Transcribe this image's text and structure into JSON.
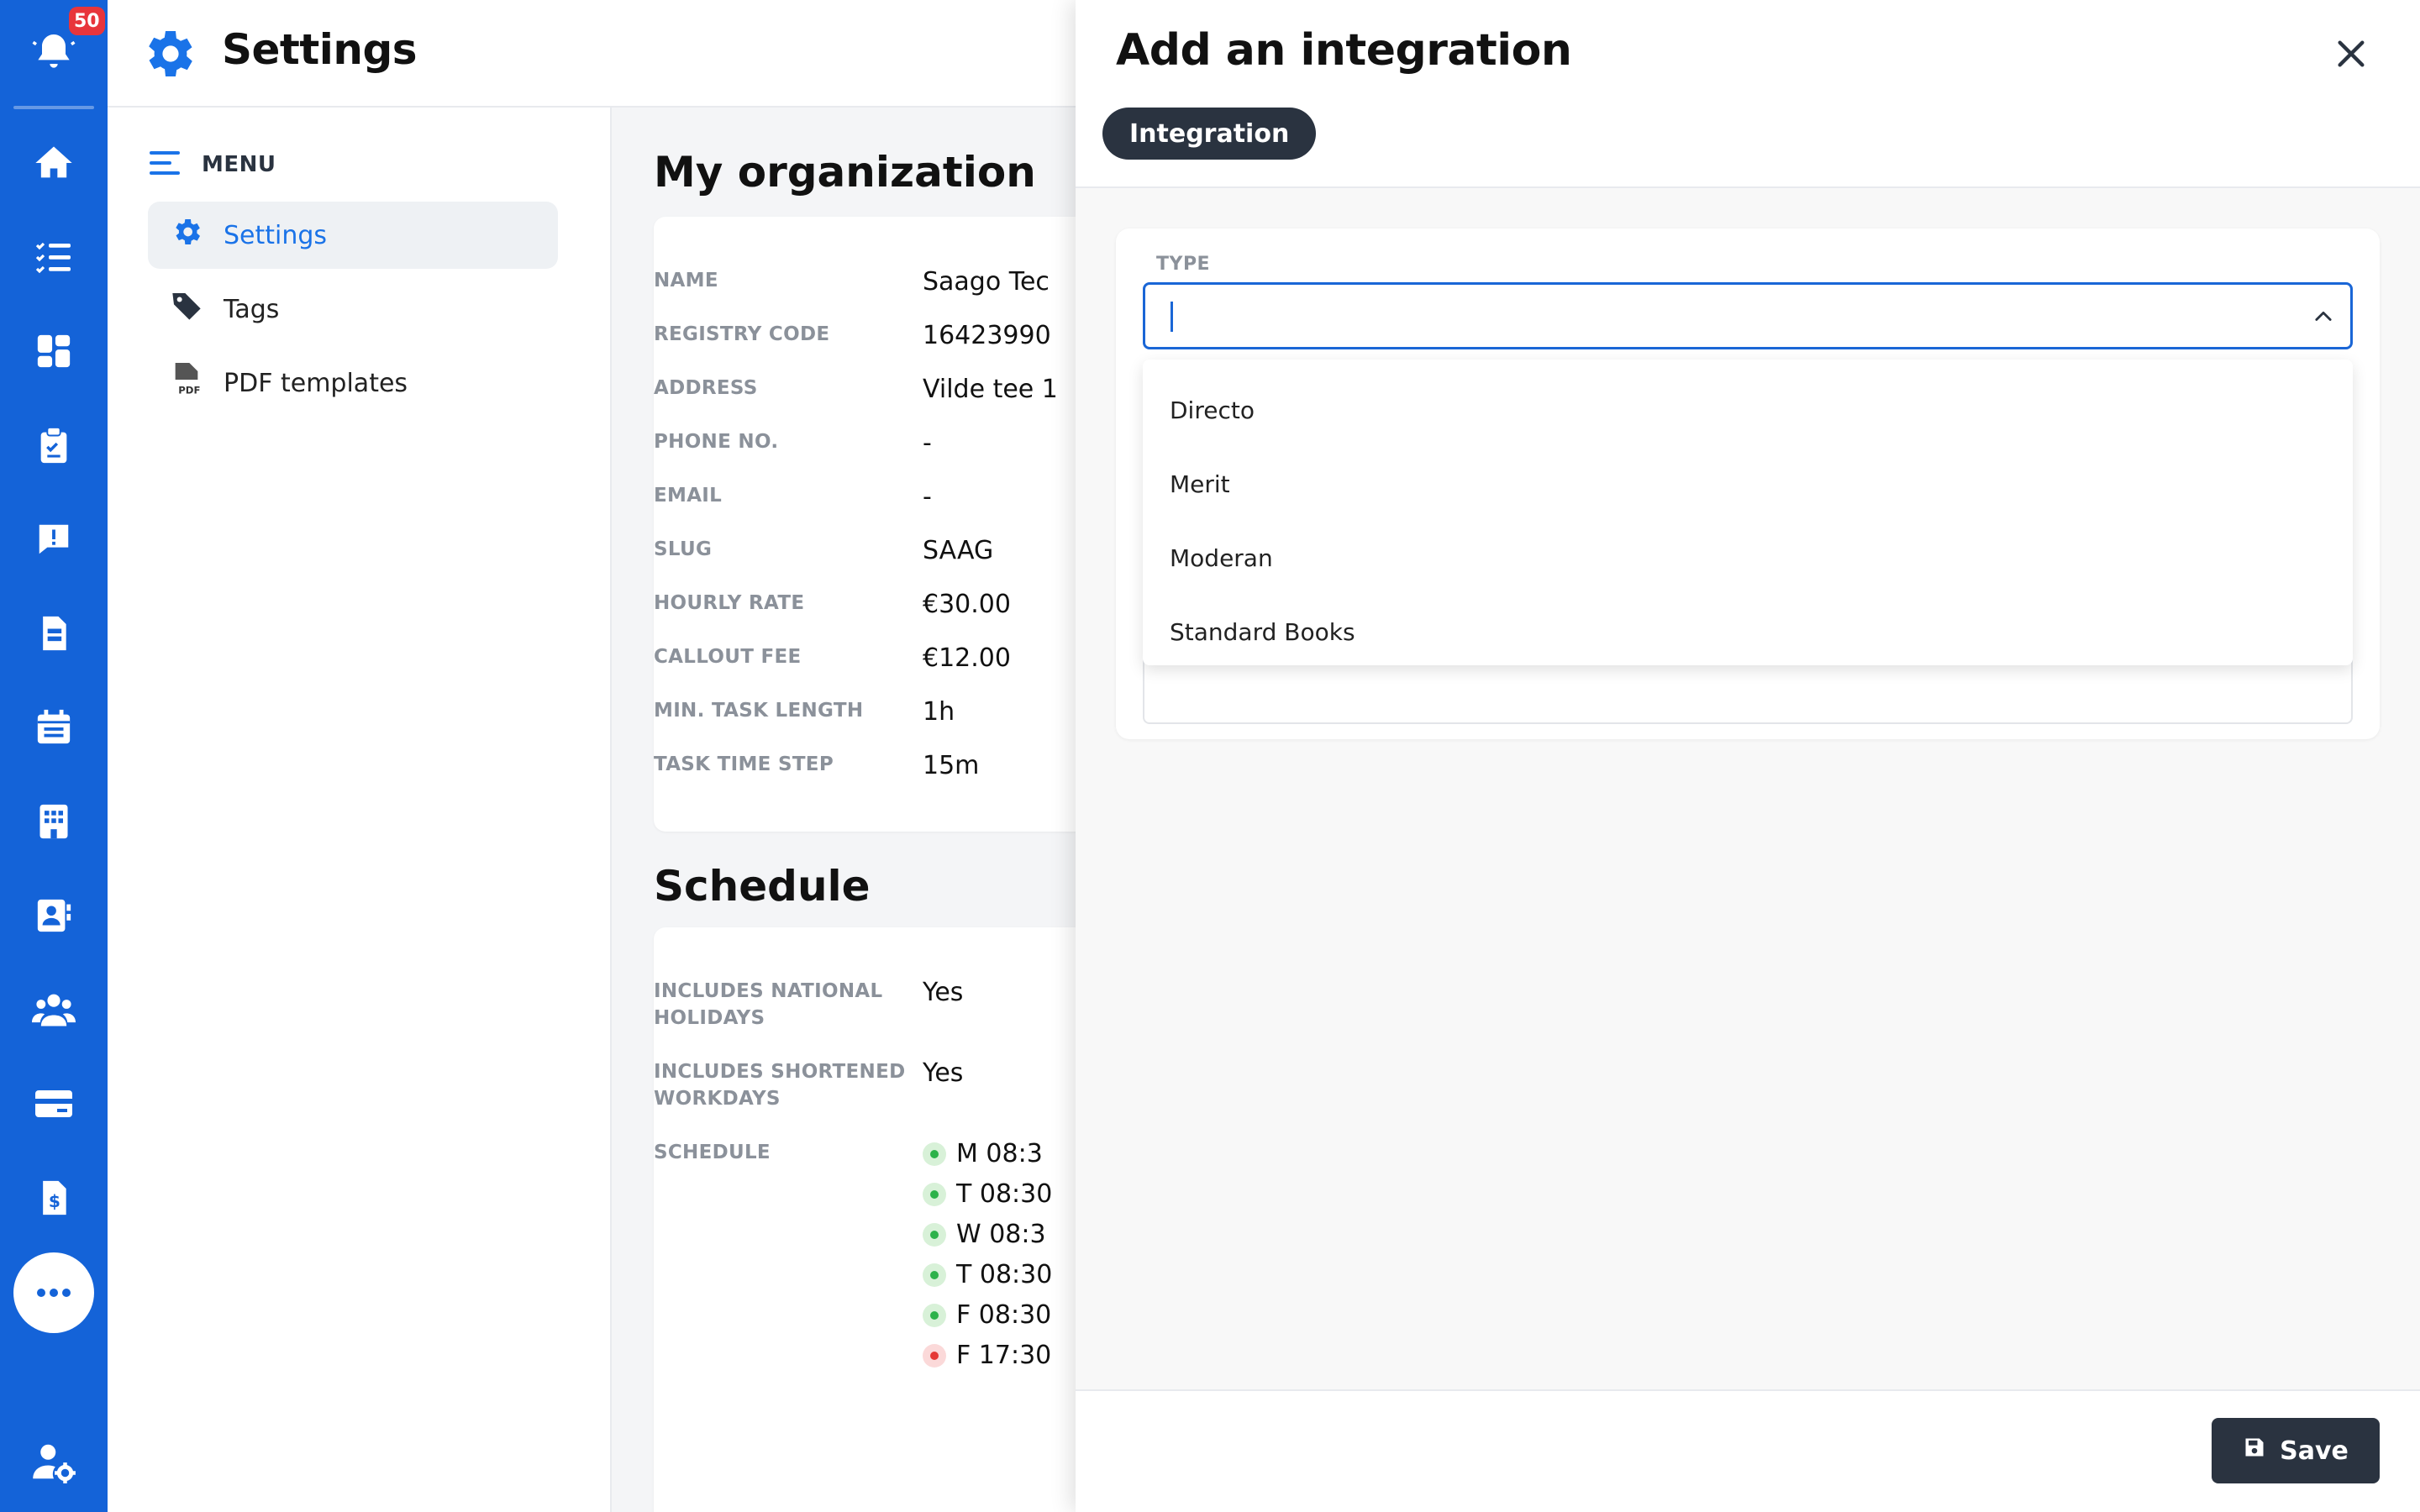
{
  "rail": {
    "notification_count": "50",
    "items": [
      "bell-icon",
      "home-icon",
      "checklist-icon",
      "dashboard-icon",
      "clipboard-icon",
      "alert-message-icon",
      "document-icon",
      "calendar-icon",
      "building-icon",
      "contact-card-icon",
      "team-icon",
      "card-icon",
      "invoice-icon",
      "more-icon",
      "user-settings-icon"
    ]
  },
  "header": {
    "title": "Settings"
  },
  "submenu": {
    "title": "MENU",
    "items": [
      {
        "label": "Settings",
        "icon": "gear-icon",
        "active": true
      },
      {
        "label": "Tags",
        "icon": "tag-icon",
        "active": false
      },
      {
        "label": "PDF templates",
        "icon": "pdf-file-icon",
        "active": false
      }
    ]
  },
  "organization": {
    "heading": "My organization",
    "fields": [
      {
        "label": "NAME",
        "value": "Saago Tec"
      },
      {
        "label": "REGISTRY CODE",
        "value": "16423990"
      },
      {
        "label": "ADDRESS",
        "value": "Vilde tee 1"
      },
      {
        "label": "PHONE NO.",
        "value": "-"
      },
      {
        "label": "EMAIL",
        "value": "-"
      },
      {
        "label": "SLUG",
        "value": "SAAG"
      },
      {
        "label": "HOURLY RATE",
        "value": "€30.00"
      },
      {
        "label": "CALLOUT FEE",
        "value": "€12.00"
      },
      {
        "label": "MIN. TASK LENGTH",
        "value": "1h"
      },
      {
        "label": "TASK TIME STEP",
        "value": "15m"
      }
    ]
  },
  "schedule": {
    "heading": "Schedule",
    "national_holidays_label": "INCLUDES NATIONAL HOLIDAYS",
    "national_holidays_value": "Yes",
    "shortened_workdays_label": "INCLUDES SHORTENED WORKDAYS",
    "shortened_workdays_value": "Yes",
    "schedule_label": "SCHEDULE",
    "entries": [
      {
        "text": "M 08:3",
        "status": "green"
      },
      {
        "text": "T 08:30",
        "status": "green"
      },
      {
        "text": "W 08:3",
        "status": "green"
      },
      {
        "text": "T 08:30",
        "status": "green"
      },
      {
        "text": "F 08:30",
        "status": "green"
      },
      {
        "text": "F 17:30",
        "status": "red"
      }
    ]
  },
  "panel": {
    "title": "Add an integration",
    "tab": "Integration",
    "type_label": "TYPE",
    "type_value": "",
    "options": [
      "Directo",
      "Merit",
      "Moderan",
      "Standard Books"
    ],
    "save_label": "Save"
  },
  "colors": {
    "rail": "#1463d8",
    "accent": "#1a73e8",
    "dark": "#2a3340"
  }
}
